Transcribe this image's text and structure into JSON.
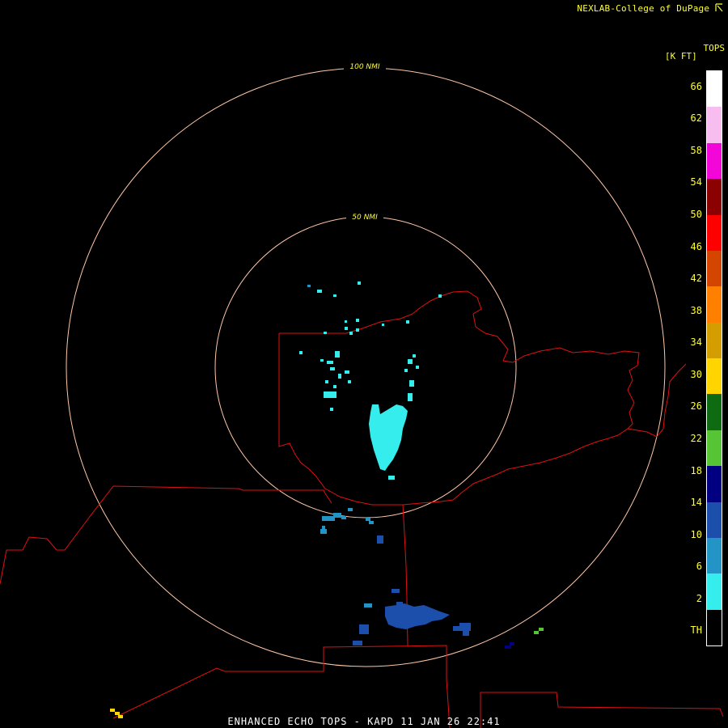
{
  "header": {
    "credit": "NEXLAB-College of DuPage",
    "credit_icon": "cod-logo-icon"
  },
  "legend": {
    "title": "TOPS",
    "units": "[K FT]",
    "labels": [
      "66",
      "62",
      "58",
      "54",
      "50",
      "46",
      "42",
      "38",
      "34",
      "30",
      "26",
      "22",
      "18",
      "14",
      "10",
      "6",
      "2",
      "TH"
    ],
    "colors": [
      "#ffffff",
      "#f7bdf1",
      "#f207d8",
      "#8b0000",
      "#ff0000",
      "#d34500",
      "#ff7f00",
      "#d49d00",
      "#ffd500",
      "#0e6b12",
      "#57c436",
      "#000080",
      "#1c4fab",
      "#2394c6",
      "#36eded",
      "#000000"
    ]
  },
  "map": {
    "rings": [
      {
        "label": "100 NMI"
      },
      {
        "label": "50 NMI"
      }
    ],
    "ring_color": "#ffc7a7",
    "boundary_color": "#e01010"
  },
  "footer": {
    "product_title": "ENHANCED ECHO TOPS - KAPD 11 JAN 26 22:41"
  }
}
